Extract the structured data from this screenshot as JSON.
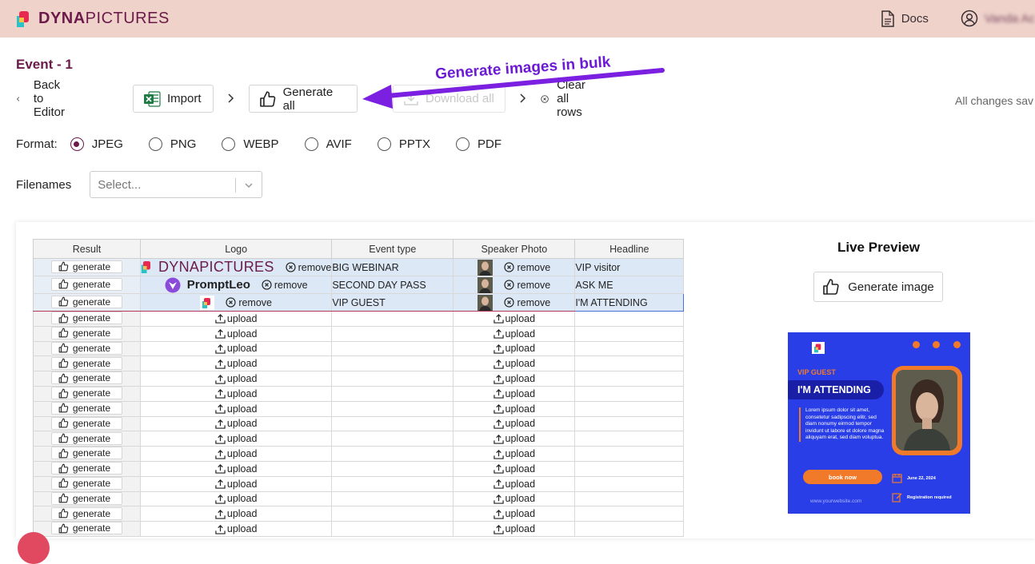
{
  "header": {
    "brand_dyna": "DYNA",
    "brand_pictures": "PICTURES",
    "docs_label": "Docs",
    "user_name": "Vanda Ac"
  },
  "page_title": "Event - 1",
  "toolbar": {
    "back_label": "Back to Editor",
    "import_label": "Import",
    "generate_all_label": "Generate all",
    "download_all_label": "Download all",
    "clear_rows_label": "Clear all rows",
    "saved_status": "All changes sav"
  },
  "annotation": "Generate images in bulk",
  "format": {
    "label": "Format:",
    "options": [
      "JPEG",
      "PNG",
      "WEBP",
      "AVIF",
      "PPTX",
      "PDF"
    ],
    "selected": "JPEG"
  },
  "filenames": {
    "label": "Filenames",
    "placeholder": "Select..."
  },
  "grid": {
    "columns": [
      "Result",
      "Logo",
      "Event type",
      "Speaker Photo",
      "Headline"
    ],
    "generate_label": "generate",
    "remove_label": "remove",
    "upload_label": "upload",
    "rows": [
      {
        "logo": "DYNAPICTURES",
        "event_type": "BIG WEBINAR",
        "headline": "VIP visitor"
      },
      {
        "logo": "PromptLeo",
        "event_type": "SECOND DAY PASS",
        "headline": "ASK ME"
      },
      {
        "logo": "",
        "event_type": "VIP GUEST",
        "headline": "I'M ATTENDING"
      }
    ],
    "empty_row_count": 15
  },
  "live_preview": {
    "title": "Live Preview",
    "generate_label": "Generate image",
    "card": {
      "guest_label": "VIP GUEST",
      "headline": "I'M ATTENDING",
      "body": "Lorem ipsum dolor sit amet, consetetur sadipscing elitr, sed diam nonumy eirmod tempor invidunt ut labore et dolore magna aliquyam erat, sed diam voluptua.",
      "book_label": "book now",
      "date": "June 22, 2024",
      "registration": "Registration required",
      "website": "www.yourwebsite.com"
    }
  },
  "colors": {
    "topbar": "#efd3cb",
    "brand": "#6b1a49",
    "annotation": "#6d1ad6",
    "card_bg": "#2a3ee8",
    "card_accent": "#f07a2a"
  }
}
